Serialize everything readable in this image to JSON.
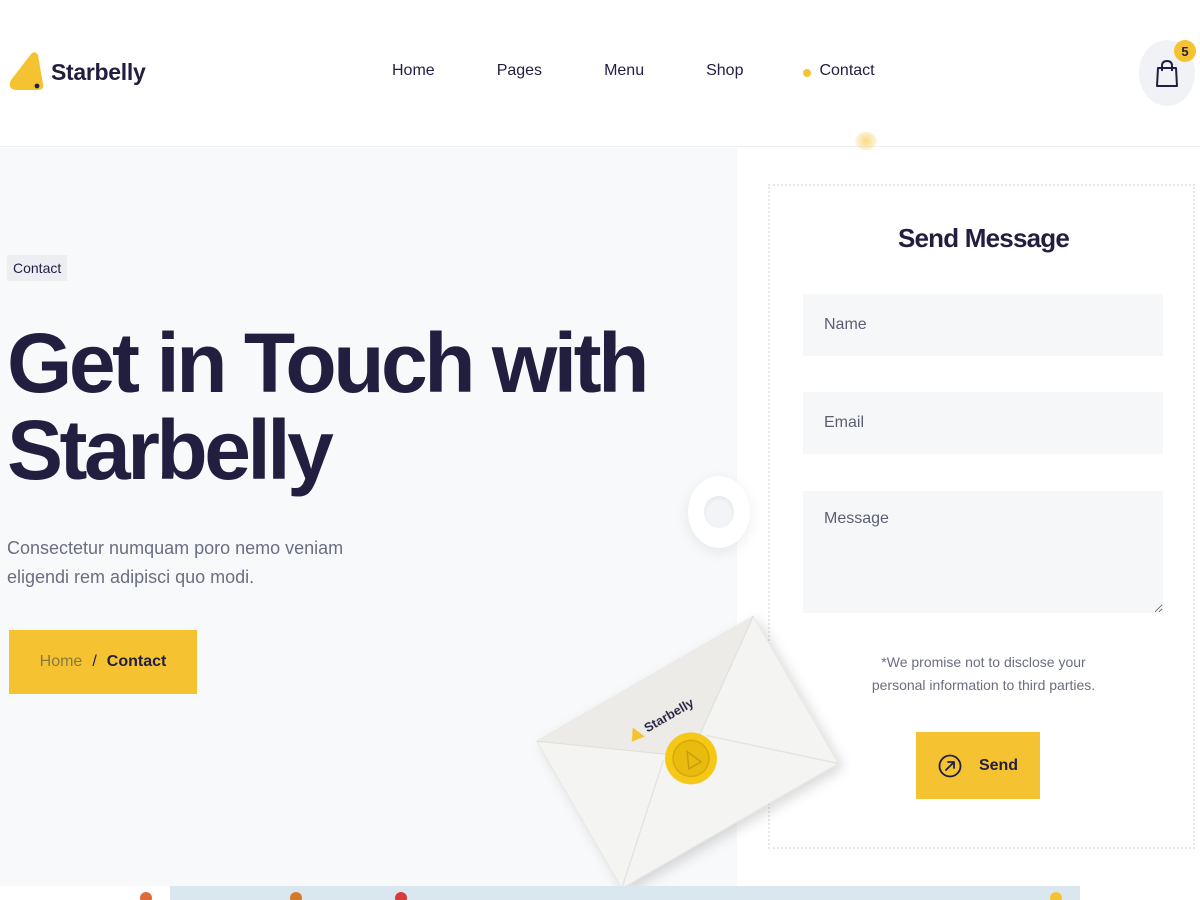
{
  "brand": {
    "name": "Starbelly",
    "accent_color": "#f5c332",
    "text_color": "#221e3f"
  },
  "nav": {
    "items": [
      {
        "label": "Home"
      },
      {
        "label": "Pages"
      },
      {
        "label": "Menu"
      },
      {
        "label": "Shop"
      },
      {
        "label": "Contact",
        "active": true
      }
    ]
  },
  "cart": {
    "icon": "shopping-bag-icon",
    "count": "5"
  },
  "hero": {
    "tag": "Contact",
    "title": "Get in Touch with Starbelly",
    "description": "Consectetur numquam poro nemo veniam eligendi rem adipisci quo modi.",
    "breadcrumb": {
      "home": "Home",
      "separator": "/",
      "current": "Contact"
    }
  },
  "form": {
    "title": "Send Message",
    "name_placeholder": "Name",
    "email_placeholder": "Email",
    "message_placeholder": "Message",
    "promise_line1": "*We promise not to disclose your",
    "promise_line2": "personal information to third parties.",
    "send_label": "Send",
    "send_icon": "arrow-up-right-circle-icon"
  },
  "envelope": {
    "brand_text": "Starbelly"
  }
}
